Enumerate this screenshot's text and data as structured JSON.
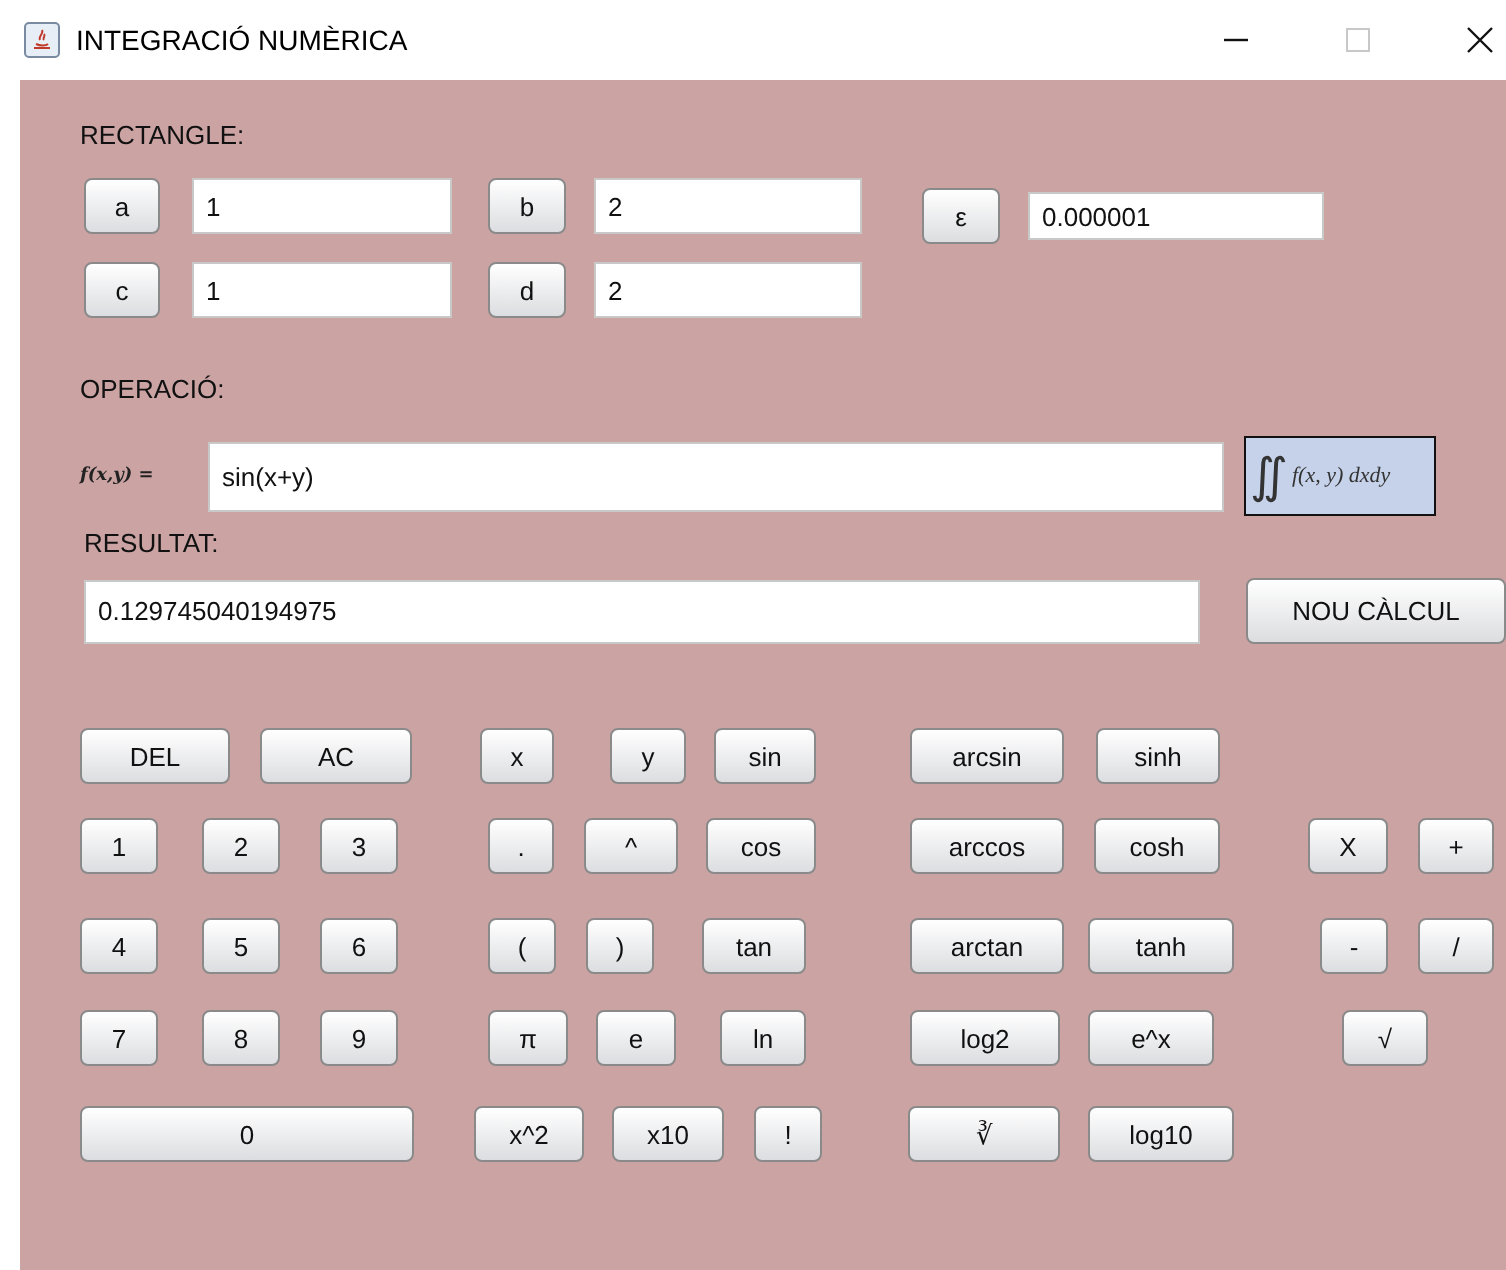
{
  "window": {
    "title": "INTEGRACIÓ NUMÈRICA"
  },
  "rectangle": {
    "label": "RECTANGLE:",
    "bounds": [
      {
        "name": "a",
        "value": "1"
      },
      {
        "name": "b",
        "value": "2"
      },
      {
        "name": "c",
        "value": "1"
      },
      {
        "name": "d",
        "value": "2"
      }
    ],
    "epsilon": {
      "name": "ε",
      "value": "0.000001"
    }
  },
  "operation": {
    "label": "OPERACIÓ:",
    "function_label": "f(x,y) =",
    "value": "sin(x+y)",
    "integral": {
      "symbol": "∬",
      "integrand": "f(x, y) dxdy"
    }
  },
  "result": {
    "label": "RESULTAT:",
    "value": "0.129745040194975",
    "button": "NOU CÀLCUL"
  },
  "keypad": [
    [
      "DEL",
      "AC",
      "x",
      "y",
      "sin",
      "arcsin",
      "sinh"
    ],
    [
      "1",
      "2",
      "3",
      ".",
      "^",
      "cos",
      "arccos",
      "cosh",
      "X",
      "+"
    ],
    [
      "4",
      "5",
      "6",
      "(",
      ")",
      "tan",
      "arctan",
      "tanh",
      "-",
      "/"
    ],
    [
      "7",
      "8",
      "9",
      "π",
      "e",
      "ln",
      "log2",
      "e^x",
      "√"
    ],
    [
      "0",
      "x^2",
      "x10",
      "!",
      "∛",
      "log10"
    ]
  ]
}
